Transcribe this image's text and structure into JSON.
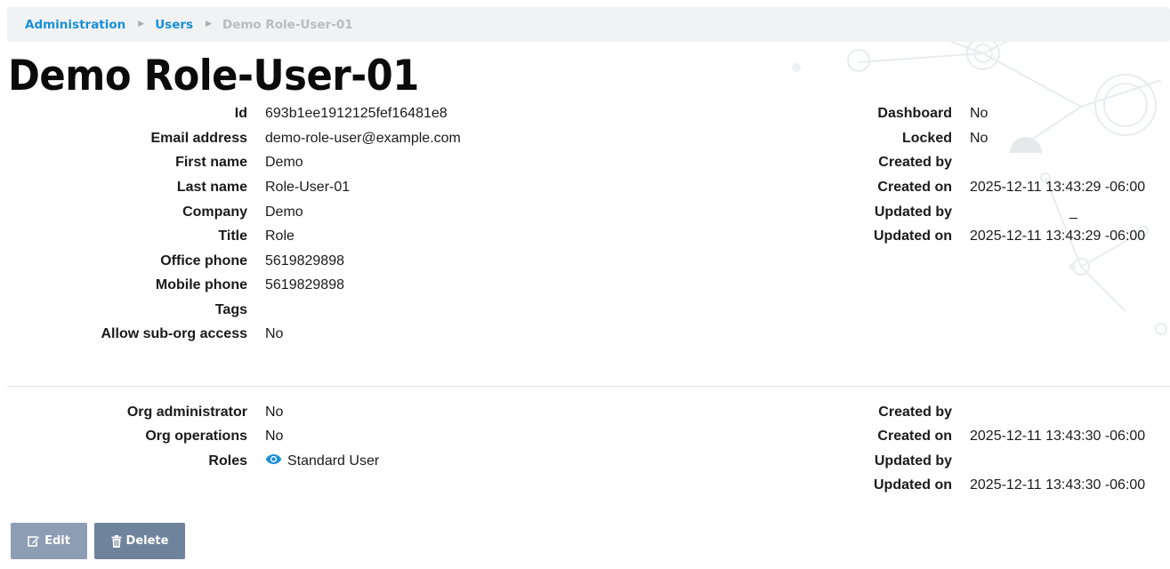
{
  "breadcrumb": {
    "items": [
      "Administration",
      "Users"
    ],
    "current": "Demo Role-User-01"
  },
  "page_title": "Demo Role-User-01",
  "user_fields": [
    {
      "label": "Id",
      "value": "693b1ee1912125fef16481e8"
    },
    {
      "label": "Email address",
      "value": "demo-role-user@example.com"
    },
    {
      "label": "First name",
      "value": "Demo"
    },
    {
      "label": "Last name",
      "value": "Role-User-01"
    },
    {
      "label": "Company",
      "value": "Demo"
    },
    {
      "label": "Title",
      "value": "Role"
    },
    {
      "label": "Office phone",
      "value": "5619829898"
    },
    {
      "label": "Mobile phone",
      "value": "5619829898"
    },
    {
      "label": "Tags",
      "value": ""
    },
    {
      "label": "Allow sub-org access",
      "value": "No"
    }
  ],
  "user_meta": [
    {
      "label": "Dashboard",
      "value": "No"
    },
    {
      "label": "Locked",
      "value": "No"
    },
    {
      "label": "Created by",
      "value": ""
    },
    {
      "label": "Created on",
      "value": "2025-12-11 13:43:29 -06:00"
    },
    {
      "label": "Updated by",
      "value": "_"
    },
    {
      "label": "Updated on",
      "value": "2025-12-11 13:43:29 -06:00"
    }
  ],
  "org_fields": [
    {
      "label": "Org administrator",
      "value": "No"
    },
    {
      "label": "Org operations",
      "value": "No"
    },
    {
      "label": "Roles",
      "value": "Standard User",
      "icon": "eye-icon"
    }
  ],
  "org_meta": [
    {
      "label": "Created by",
      "value": ""
    },
    {
      "label": "Created on",
      "value": "2025-12-11 13:43:30 -06:00"
    },
    {
      "label": "Updated by",
      "value": ""
    },
    {
      "label": "Updated on",
      "value": "2025-12-11 13:43:30 -06:00"
    }
  ],
  "actions": {
    "edit_label": "Edit",
    "edit_icon": "edit-icon",
    "delete_label": "Delete",
    "delete_icon": "trash-icon"
  },
  "colors": {
    "link": "#1a8fd8",
    "breadcrumb_bg": "#f0f2f4",
    "button_edit": "#8d9db3",
    "button_delete": "#6f849c"
  }
}
